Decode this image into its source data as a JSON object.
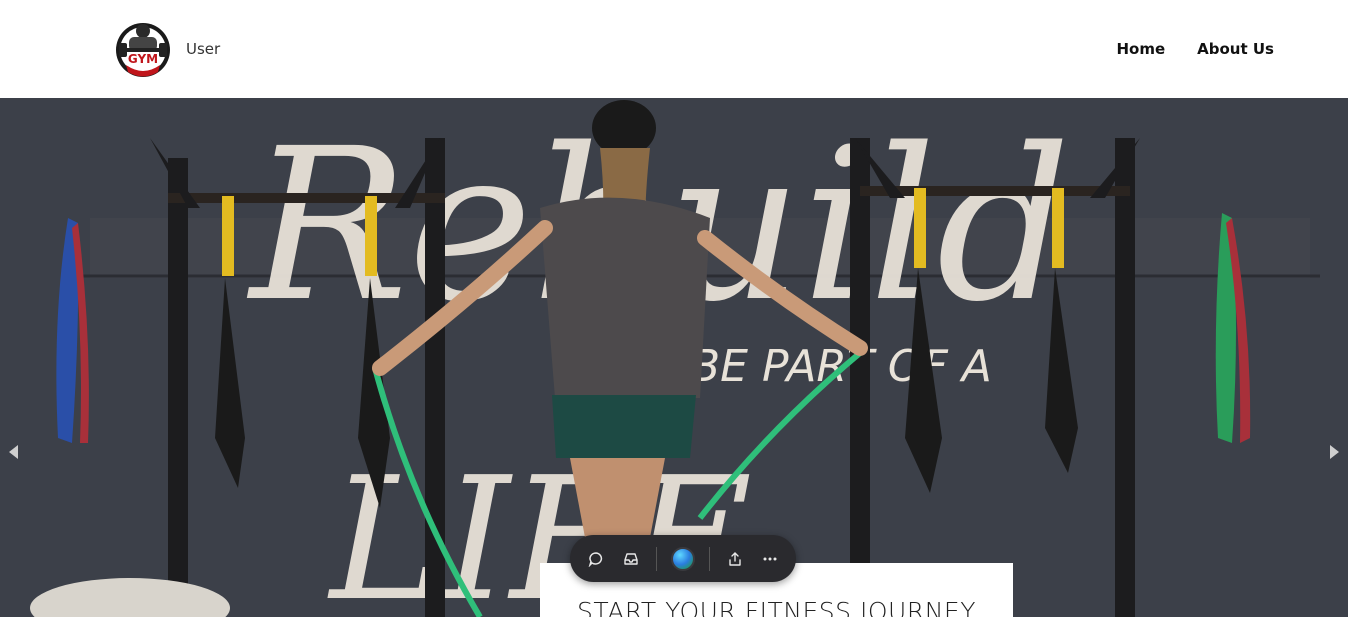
{
  "header": {
    "logo_icon": "gym-logo-icon",
    "logo_text": "GYM",
    "user_label": "User",
    "nav": [
      {
        "label": "Home"
      },
      {
        "label": "About Us"
      }
    ]
  },
  "hero": {
    "wall_text_1": "Rebuild",
    "wall_text_2": "BE PART OF A",
    "wall_text_3": "LIFE",
    "prev_icon": "caret-left-icon",
    "next_icon": "caret-right-icon",
    "card_title": "START YOUR FITNESS JOURNEY"
  },
  "toolbar": {
    "icons": [
      "comment-icon",
      "inbox-icon",
      "avatar",
      "share-icon",
      "more-icon"
    ]
  },
  "colors": {
    "wall": "#3b3f48",
    "rack": "#1c1c1e",
    "strap_yellow": "#e3bb21",
    "rope_green": "#2fbf7a",
    "toolbar_bg": "#2a2a2e"
  }
}
